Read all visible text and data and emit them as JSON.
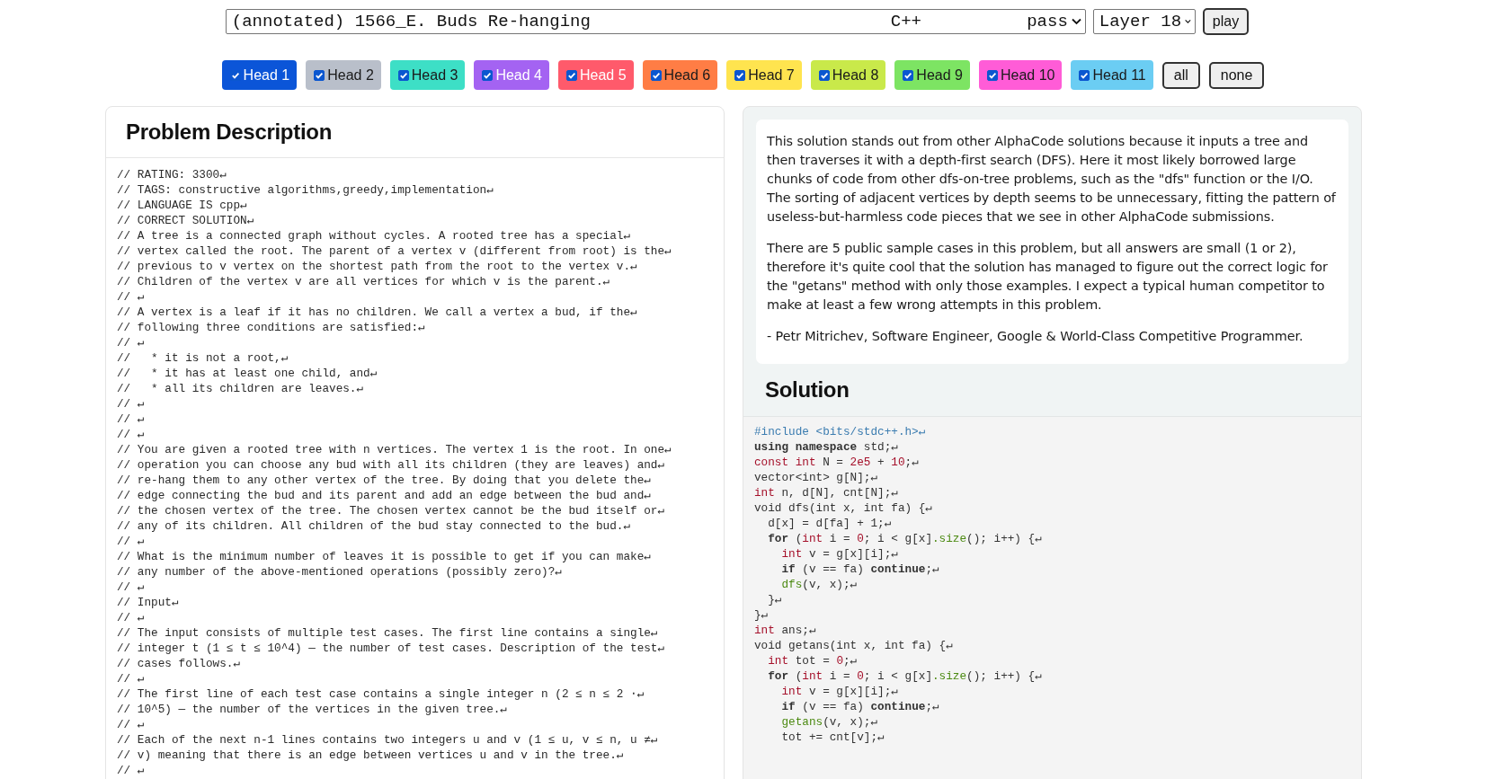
{
  "toolbar": {
    "problem_select": {
      "title": "(annotated) 1566_E. Buds Re-hanging",
      "language": "C++",
      "verdict": "pass"
    },
    "layer_select": "Layer 18",
    "play_button": "play"
  },
  "heads": [
    {
      "label": "Head 1",
      "checked": true,
      "color": "#0b55d8"
    },
    {
      "label": "Head 2",
      "checked": true,
      "color": "#b9bfca"
    },
    {
      "label": "Head 3",
      "checked": true,
      "color": "#3ddfc6"
    },
    {
      "label": "Head 4",
      "checked": true,
      "color": "#a463f2"
    },
    {
      "label": "Head 5",
      "checked": true,
      "color": "#ff5a6b"
    },
    {
      "label": "Head 6",
      "checked": true,
      "color": "#ff7d45"
    },
    {
      "label": "Head 7",
      "checked": true,
      "color": "#ffe44f"
    },
    {
      "label": "Head 8",
      "checked": true,
      "color": "#c9e94a"
    },
    {
      "label": "Head 9",
      "checked": true,
      "color": "#7de463"
    },
    {
      "label": "Head 10",
      "checked": true,
      "color": "#ff5cd7"
    },
    {
      "label": "Head 11",
      "checked": true,
      "color": "#6bcdf3"
    }
  ],
  "head_buttons": [
    "all",
    "none"
  ],
  "problem": {
    "title": "Problem Description",
    "lines": [
      "// RATING: 3300↵",
      "// TAGS: constructive algorithms,greedy,implementation↵",
      "// LANGUAGE IS cpp↵",
      "// CORRECT SOLUTION↵",
      "// A tree is a connected graph without cycles. A rooted tree has a special↵",
      "// vertex called the root. The parent of a vertex v (different from root) is the↵",
      "// previous to v vertex on the shortest path from the root to the vertex v.↵",
      "// Children of the vertex v are all vertices for which v is the parent.↵",
      "// ↵",
      "// A vertex is a leaf if it has no children. We call a vertex a bud, if the↵",
      "// following three conditions are satisfied:↵",
      "// ↵",
      "//   * it is not a root,↵",
      "//   * it has at least one child, and↵",
      "//   * all its children are leaves.↵",
      "// ↵",
      "// ↵",
      "// ↵",
      "// You are given a rooted tree with n vertices. The vertex 1 is the root. In one↵",
      "// operation you can choose any bud with all its children (they are leaves) and↵",
      "// re-hang them to any other vertex of the tree. By doing that you delete the↵",
      "// edge connecting the bud and its parent and add an edge between the bud and↵",
      "// the chosen vertex of the tree. The chosen vertex cannot be the bud itself or↵",
      "// any of its children. All children of the bud stay connected to the bud.↵",
      "// ↵",
      "// What is the minimum number of leaves it is possible to get if you can make↵",
      "// any number of the above-mentioned operations (possibly zero)?↵",
      "// ↵",
      "// Input↵",
      "// ↵",
      "// The input consists of multiple test cases. The first line contains a single↵",
      "// integer t (1 ≤ t ≤ 10^4) — the number of test cases. Description of the test↵",
      "// cases follows.↵",
      "// ↵",
      "// The first line of each test case contains a single integer n (2 ≤ n ≤ 2 ⋅↵",
      "// 10^5) — the number of the vertices in the given tree.↵",
      "// ↵",
      "// Each of the next n-1 lines contains two integers u and v (1 ≤ u, v ≤ n, u ≠↵",
      "// v) meaning that there is an edge between vertices u and v in the tree.↵",
      "// ↵"
    ]
  },
  "commentary": {
    "paragraphs": [
      "This solution stands out from other AlphaCode solutions because it inputs a tree and then traverses it with a depth-first search (DFS). Here it most likely borrowed large chunks of code from other dfs-on-tree problems, such as the \"dfs\" function or the I/O. The sorting of adjacent vertices by depth seems to be unnecessary, fitting the pattern of useless-but-harmless code pieces that we see in other AlphaCode submissions.",
      "There are 5 public sample cases in this problem, but all answers are small (1 or 2), therefore it's quite cool that the solution has managed to figure out the correct logic for the \"getans\" method with only those examples. I expect a typical human competitor to make at least a few wrong attempts in this problem.",
      "- Petr Mitrichev, Software Engineer, Google & World-Class Competitive Programmer."
    ]
  },
  "solution": {
    "title": "Solution",
    "lines": [
      [
        {
          "kind": "pre",
          "text": "#include <bits/stdc++.h>↵"
        }
      ],
      [
        {
          "kind": "kw",
          "text": "using namespace"
        },
        {
          "kind": "plain",
          "text": " std;↵"
        }
      ],
      [
        {
          "kind": "type",
          "text": "const int"
        },
        {
          "kind": "plain",
          "text": " N = "
        },
        {
          "kind": "num",
          "text": "2e5"
        },
        {
          "kind": "plain",
          "text": " + "
        },
        {
          "kind": "num",
          "text": "10"
        },
        {
          "kind": "plain",
          "text": ";↵"
        }
      ],
      [
        {
          "kind": "plain",
          "text": "vector<int> g[N];↵"
        }
      ],
      [
        {
          "kind": "type",
          "text": "int"
        },
        {
          "kind": "plain",
          "text": " n, d[N], cnt[N];↵"
        }
      ],
      [
        {
          "kind": "plain",
          "text": "void dfs(int x, int fa) {↵"
        }
      ],
      [
        {
          "kind": "plain",
          "text": "  d[x] = d[fa] + 1;↵"
        }
      ],
      [
        {
          "kind": "kw",
          "text": "  for"
        },
        {
          "kind": "plain",
          "text": " ("
        },
        {
          "kind": "type",
          "text": "int"
        },
        {
          "kind": "plain",
          "text": " i = "
        },
        {
          "kind": "num",
          "text": "0"
        },
        {
          "kind": "plain",
          "text": "; i < g[x]"
        },
        {
          "kind": "fn",
          "text": ".size"
        },
        {
          "kind": "plain",
          "text": "(); i++) {↵"
        }
      ],
      [
        {
          "kind": "type",
          "text": "    int"
        },
        {
          "kind": "plain",
          "text": " v = g[x][i];↵"
        }
      ],
      [
        {
          "kind": "kw",
          "text": "    if"
        },
        {
          "kind": "plain",
          "text": " (v == fa) "
        },
        {
          "kind": "kw",
          "text": "continue"
        },
        {
          "kind": "plain",
          "text": ";↵"
        }
      ],
      [
        {
          "kind": "fn",
          "text": "    dfs"
        },
        {
          "kind": "plain",
          "text": "(v, x);↵"
        }
      ],
      [
        {
          "kind": "plain",
          "text": "  }↵"
        }
      ],
      [
        {
          "kind": "plain",
          "text": "}↵"
        }
      ],
      [
        {
          "kind": "type",
          "text": "int"
        },
        {
          "kind": "plain",
          "text": " ans;↵"
        }
      ],
      [
        {
          "kind": "plain",
          "text": "void getans(int x, int fa) {↵"
        }
      ],
      [
        {
          "kind": "type",
          "text": "  int"
        },
        {
          "kind": "plain",
          "text": " tot = "
        },
        {
          "kind": "num",
          "text": "0"
        },
        {
          "kind": "plain",
          "text": ";↵"
        }
      ],
      [
        {
          "kind": "kw",
          "text": "  for"
        },
        {
          "kind": "plain",
          "text": " ("
        },
        {
          "kind": "type",
          "text": "int"
        },
        {
          "kind": "plain",
          "text": " i = "
        },
        {
          "kind": "num",
          "text": "0"
        },
        {
          "kind": "plain",
          "text": "; i < g[x]"
        },
        {
          "kind": "fn",
          "text": ".size"
        },
        {
          "kind": "plain",
          "text": "(); i++) {↵"
        }
      ],
      [
        {
          "kind": "type",
          "text": "    int"
        },
        {
          "kind": "plain",
          "text": " v = g[x][i];↵"
        }
      ],
      [
        {
          "kind": "kw",
          "text": "    if"
        },
        {
          "kind": "plain",
          "text": " (v == fa) "
        },
        {
          "kind": "kw",
          "text": "continue"
        },
        {
          "kind": "plain",
          "text": ";↵"
        }
      ],
      [
        {
          "kind": "fn",
          "text": "    getans"
        },
        {
          "kind": "plain",
          "text": "(v, x);↵"
        }
      ],
      [
        {
          "kind": "plain",
          "text": "    tot += cnt[v];↵"
        }
      ]
    ]
  }
}
